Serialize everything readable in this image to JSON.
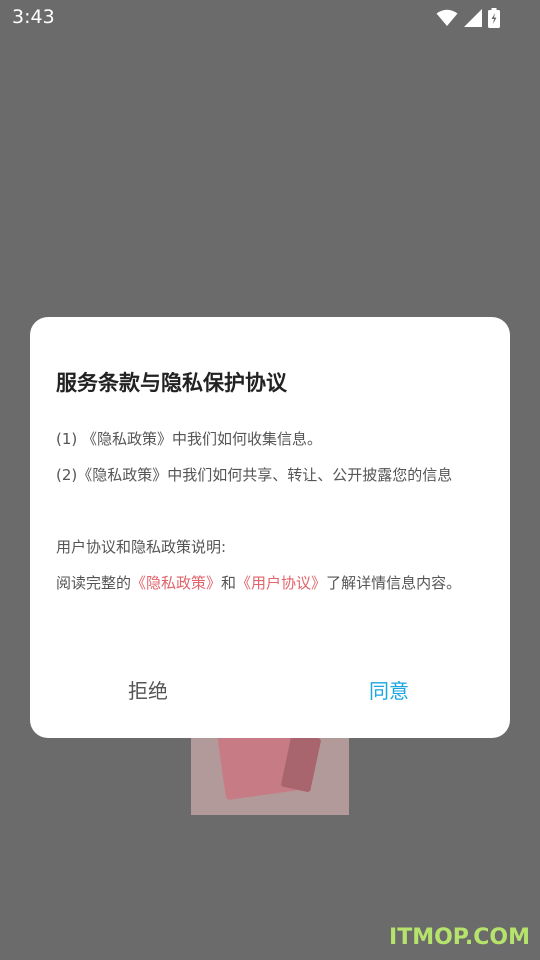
{
  "status_bar": {
    "time": "3:43",
    "icons": [
      "wifi-icon",
      "signal-icon",
      "battery-charging-icon"
    ]
  },
  "dialog": {
    "title": "服务条款与隐私保护协议",
    "paragraphs": [
      "(1) 《隐私政策》中我们如何收集信息。",
      "(2)《隐私政策》中我们如何共享、转让、公开披露您的信息",
      "用户协议和隐私政策说明:"
    ],
    "read_notice": {
      "prefix": "阅读完整的",
      "privacy_link": "《隐私政策》",
      "conjunction": "和",
      "user_link": "《用户协议》",
      "suffix": "了解详情信息内容。"
    },
    "refuse_label": "拒绝",
    "agree_label": "同意",
    "colors": {
      "link": "#e2636b",
      "agree": "#1aa6e0"
    }
  },
  "watermark": "ITMOP.COM"
}
